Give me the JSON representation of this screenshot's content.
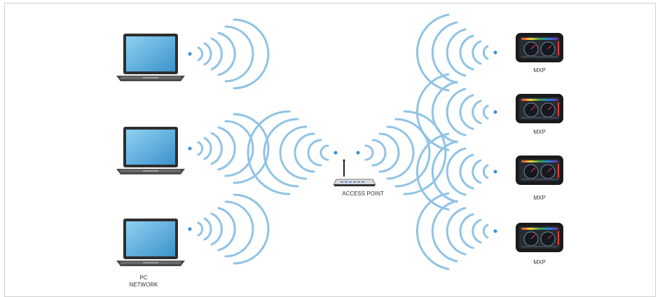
{
  "pc_network": {
    "line1": "PC",
    "line2": "NETWORK"
  },
  "access_point": {
    "label": "ACCESS POINT"
  },
  "devices": [
    {
      "label": "MXP"
    },
    {
      "label": "MXP"
    },
    {
      "label": "MXP"
    },
    {
      "label": "MXP"
    }
  ],
  "colors": {
    "wave": "#8fc3e6",
    "dot": "#3a8fd0",
    "laptop_screen": "#6fb8e6",
    "laptop_body": "#3a3a3a",
    "frame": "#cfcfcf"
  }
}
